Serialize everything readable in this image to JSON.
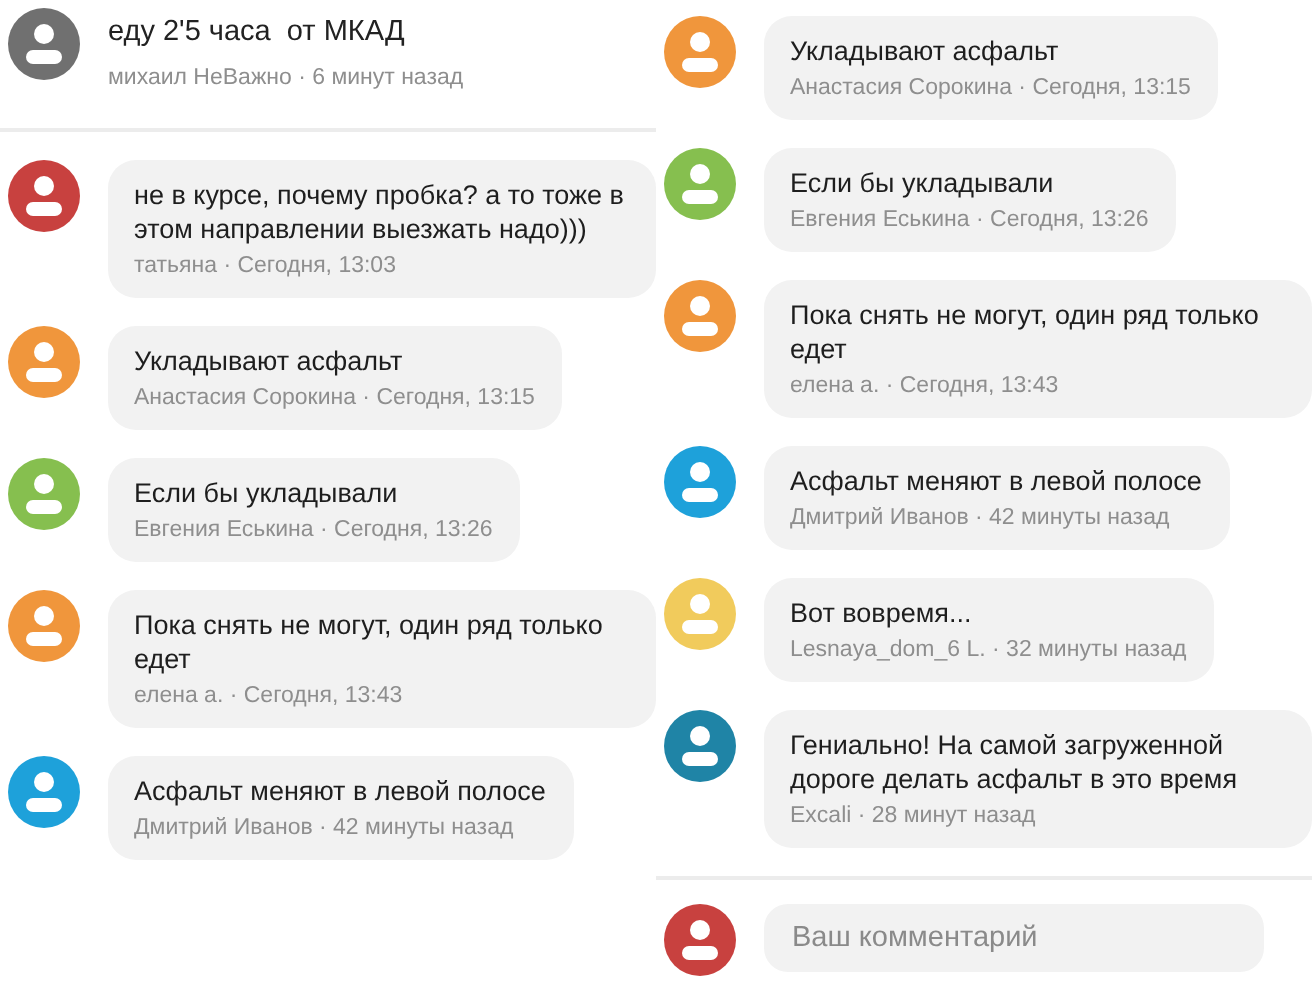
{
  "panels": [
    {
      "post": {
        "title": "еду 2'5 часа  от МКАД",
        "meta": "михаил НеВажно · 6 минут назад",
        "color": "#707070"
      },
      "comments": [
        {
          "text": "не в курсе, почему пробка? а то тоже в этом направлении выезжать надо)))",
          "meta": "татьяна · Сегодня, 13:03",
          "color": "#c8413f"
        },
        {
          "text": "Укладывают асфальт",
          "meta": "Анастасия Сорокина · Сегодня, 13:15",
          "color": "#f0963c"
        },
        {
          "text": "Если бы укладывали",
          "meta": "Евгения Еськина · Сегодня, 13:26",
          "color": "#86bf4f"
        },
        {
          "text": "Пока снять не могут, один ряд только едет",
          "meta": "елена а. · Сегодня, 13:43",
          "color": "#f0963c"
        },
        {
          "text": "Асфальт меняют в левой полосе",
          "meta": "Дмитрий Иванов · 42 минуты назад",
          "color": "#1ea1da"
        }
      ]
    },
    {
      "comments": [
        {
          "text": "Укладывают асфальт",
          "meta": "Анастасия Сорокина · Сегодня, 13:15",
          "color": "#f0963c"
        },
        {
          "text": "Если бы укладывали",
          "meta": "Евгения Еськина · Сегодня, 13:26",
          "color": "#86bf4f"
        },
        {
          "text": "Пока снять не могут, один ряд только едет",
          "meta": "елена а. · Сегодня, 13:43",
          "color": "#f0963c"
        },
        {
          "text": "Асфальт меняют в левой полосе",
          "meta": "Дмитрий Иванов · 42 минуты назад",
          "color": "#1ea1da"
        },
        {
          "text": "Вот вовремя...",
          "meta": "Lesnaya_dom_6 L. · 32 минуты назад",
          "color": "#f1cb5c"
        },
        {
          "text": "Гениально! На самой загруженной дороге делать асфальт в это время",
          "meta": "Excali · 28 минут назад",
          "color": "#1f84a6"
        }
      ],
      "composer": {
        "placeholder": "Ваш комментарий",
        "color": "#c8413f"
      }
    }
  ]
}
